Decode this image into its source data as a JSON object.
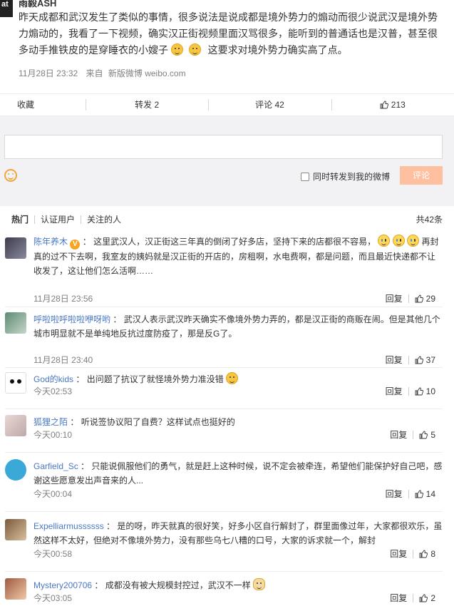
{
  "post": {
    "author": "雨毅ASH",
    "avatar_text": "at",
    "text_parts": [
      "昨天成都和武汉发生了类似的事情，很多说法是说成都是境外势力的煽动而很少说武汉是境外势力煽动的，我看了一下视频，确实汉正街视频里面汉骂很多，能听到的普通话也是汉普，甚至很多动手推铁皮的是穿睡衣的小嫂子",
      "这要求对境外势力确实高了点。"
    ],
    "date": "11月28日 23:32",
    "source_prefix": "来自",
    "source": "新版微博 weibo.com"
  },
  "actions": {
    "favorite": "收藏",
    "repost": "转发 2",
    "comment": "评论 42",
    "like": "213"
  },
  "compose": {
    "forward_label": "同时转发到我的微博",
    "submit_label": "评论"
  },
  "filters": {
    "hot": "热门",
    "verified": "认证用户",
    "following": "关注的人",
    "total": "共42条"
  },
  "comments": [
    {
      "nick": "陈年养木",
      "text": "这里武汉人，汉正街这三年真的倒闭了好多店，坚持下来的店都很不容易，",
      "text2": "再封真的过不下去啊，我室友的姨妈就是汉正街的开店的，房租啊，水电费啊，都是问题，而且最近快递都不让收发了，这让他们怎么活啊……",
      "time": "11月28日 23:56",
      "reply": "回复",
      "likes": "29"
    },
    {
      "nick": "呼啦啦呼啦啦咿呀哟",
      "text": "武汉人表示武汉昨天确实不像境外势力弄的，都是汉正街的商贩在闹。但是其他几个城市明显就不是单纯地反抗过度防疫了，那是反G了。",
      "time": "11月28日 23:40",
      "reply": "回复",
      "likes": "37"
    },
    {
      "nick": "God的kids",
      "text": "出问题了抗议了就怪境外势力准没错",
      "time": "今天02:53",
      "reply": "回复",
      "likes": "10"
    },
    {
      "nick": "狐狸之陌",
      "text": "听说签协议阳了自费？这样试点也挺好的",
      "time": "今天00:10",
      "reply": "回复",
      "likes": "5"
    },
    {
      "nick": "Garfield_Sc",
      "text": "只能说佩服他们的勇气，就是赶上这种时候，说不定会被牵连，希望他们能保护好自己吧，感谢这些愿意发出声音来的人...",
      "time": "今天00:04",
      "reply": "回复",
      "likes": "14"
    },
    {
      "nick": "Expelliarmussssss",
      "text": "是的呀，昨天就真的很好笑，好多小区自行解封了，群里面像过年，大家都很欢乐，虽然这样不太好，但绝对不像境外势力，没有那些乌七八糟的口号，大家的诉求就一个，解封",
      "time": "今天00:58",
      "reply": "回复",
      "likes": "8"
    },
    {
      "nick": "Mystery200706",
      "text": "成都没有被大规模封控过，武汉不一样",
      "time": "今天03:05",
      "reply": "回复",
      "likes": "2"
    }
  ]
}
